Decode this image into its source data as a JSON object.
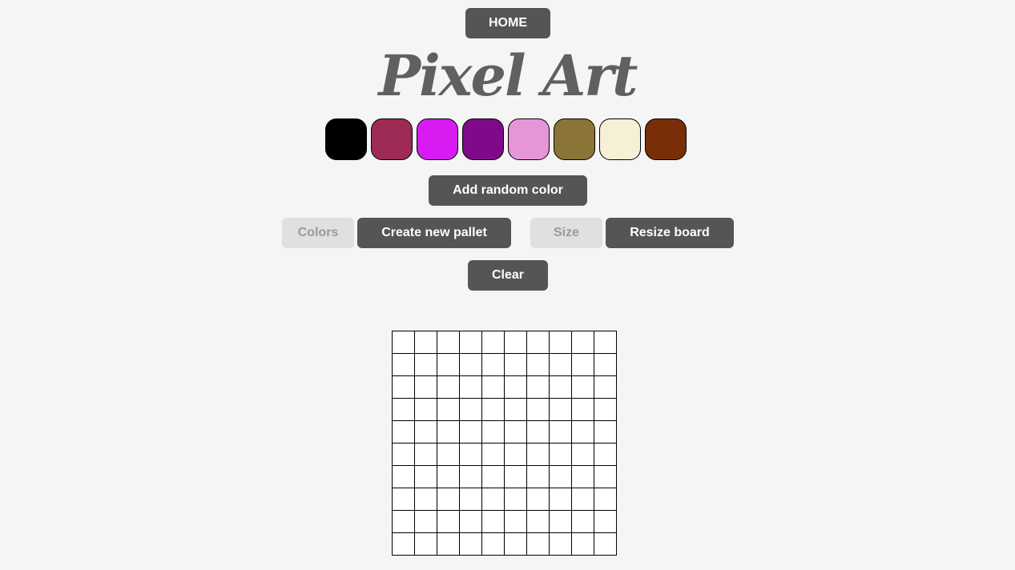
{
  "nav": {
    "home_label": "HOME"
  },
  "title": "Pixel Art",
  "palette": {
    "colors": [
      "#000000",
      "#9e2a56",
      "#d81bf0",
      "#7e0a8a",
      "#e695d8",
      "#8b7536",
      "#f5f0d6",
      "#7a2e07"
    ]
  },
  "controls": {
    "add_random_label": "Add random color",
    "colors_placeholder": "Colors",
    "create_pallet_label": "Create new pallet",
    "size_placeholder": "Size",
    "resize_label": "Resize board",
    "clear_label": "Clear"
  },
  "board": {
    "rows": 10,
    "cols": 10,
    "fill": "#ffffff"
  }
}
